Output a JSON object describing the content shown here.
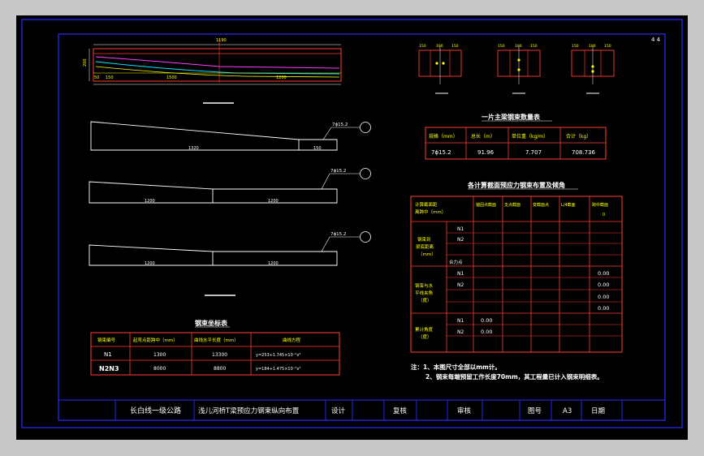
{
  "page_marker": "4 4",
  "beam_top": {
    "dims_top": [
      "1190"
    ],
    "dims_left": [
      "200"
    ],
    "dims_bottom": [
      "50",
      "150",
      "1500",
      "1200"
    ]
  },
  "sections": [
    {
      "dims": [
        "150",
        "100",
        "150"
      ]
    },
    {
      "dims": [
        "150",
        "100",
        "150"
      ]
    },
    {
      "dims": [
        "150",
        "100",
        "150"
      ]
    }
  ],
  "tendon_shapes": [
    {
      "callout": "7ϕ15.2",
      "seg_labels": [
        "1320",
        "150"
      ]
    },
    {
      "callout": "7ϕ15.2",
      "seg_labels": [
        "1200",
        "1200"
      ]
    },
    {
      "callout": "7ϕ15.2",
      "seg_labels": [
        "1200",
        "1200"
      ]
    }
  ],
  "qty_table": {
    "title": "一片主梁钢束数量表",
    "headers": [
      "规格（mm）",
      "总长（m）",
      "单位重（kg/m）",
      "合计（kg）"
    ],
    "row": [
      "7ϕ15.2",
      "91.96",
      "7.707",
      "708.736"
    ]
  },
  "stress_table": {
    "title": "各计算截面预应力钢束布置及倾角",
    "corner": "计算截面距\n离跨中（mm）",
    "col_headers": [
      "锚固点截面",
      "支点截面",
      "变截面点",
      "L/4截面",
      "跨中截面"
    ],
    "span_sub": "0",
    "group1": "钢束到\n梁底距离\n（mm）",
    "group2": "钢束与水\n平线夹角\n（度）",
    "group3": "累计角度\n（度）",
    "n1": "N1",
    "n2": "N2",
    "heli": "合力点",
    "values_span": [
      "0.00",
      "0.00",
      "0.00",
      "0.00"
    ],
    "values_cum": [
      "0.00",
      "0.00"
    ]
  },
  "coord_table": {
    "title": "钢束坐标表",
    "headers": [
      "钢束编号",
      "起弯点距跨中（mm）",
      "曲线水平长度（mm）",
      "曲线方程"
    ],
    "rows": [
      [
        "N1",
        "1300",
        "13300",
        "y=253+1.745×10⁻⁵x²"
      ],
      [
        "N2N3",
        "8000",
        "8800",
        "y=184+1.475×10⁻⁵x²"
      ]
    ]
  },
  "notes": {
    "line1": "注：1、本图尺寸全部以mm计。",
    "line2": "2、钢束每端预留工作长度70mm，其工程量已计入钢束明细表。"
  },
  "title_block": {
    "project": "长白线一级公路",
    "drawing": "浅儿河桥T梁预应力钢束纵向布置",
    "design": "设计",
    "review": "复核",
    "approve": "审核",
    "figno": "图号",
    "figval": "A3",
    "date": "日期"
  },
  "colors": {
    "background": "#000000",
    "frame": "#2a2aff",
    "line": "#ffffff",
    "table": "#ff3b2f",
    "text": "#ffffff",
    "accent": "#ffff00",
    "magenta": "#ff40ff",
    "cyan": "#00e5ff"
  }
}
